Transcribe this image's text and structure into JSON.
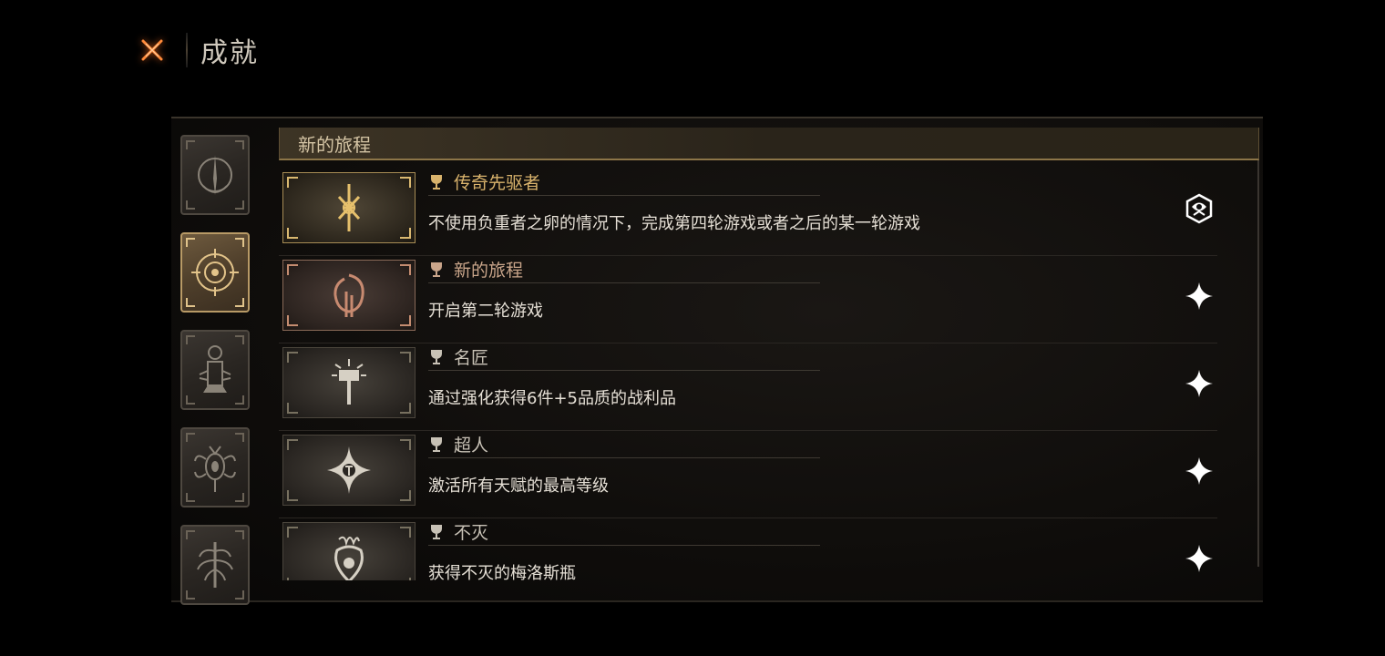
{
  "header": {
    "title": "成就"
  },
  "section": {
    "title": "新的旅程"
  },
  "side_tabs": [
    {
      "icon": "spire-emblem-icon",
      "active": false
    },
    {
      "icon": "compass-emblem-icon",
      "active": true
    },
    {
      "icon": "lantern-emblem-icon",
      "active": false
    },
    {
      "icon": "beast-emblem-icon",
      "active": false
    },
    {
      "icon": "tree-emblem-icon",
      "active": false
    }
  ],
  "achievements": [
    {
      "title": "传奇先驱者",
      "description": "不使用负重者之卵的情况下，完成第四轮游戏或者之后的某一轮游戏",
      "tier": "gold",
      "status_icon": "emblem-complete-icon"
    },
    {
      "title": "新的旅程",
      "description": "开启第二轮游戏",
      "tier": "copper",
      "status_icon": "sparkle-icon"
    },
    {
      "title": "名匠",
      "description": "通过强化获得6件+5品质的战利品",
      "tier": "silver",
      "status_icon": "sparkle-icon"
    },
    {
      "title": "超人",
      "description": "激活所有天赋的最高等级",
      "tier": "silver",
      "status_icon": "sparkle-icon"
    },
    {
      "title": "不灭",
      "description": "获得不灭的梅洛斯瓶",
      "tier": "silver",
      "status_icon": "sparkle-icon"
    }
  ],
  "colors": {
    "gold": "#d9b36c",
    "copper": "#c9a58a",
    "silver": "#c8c2b6",
    "close_accent": "#ff7a2a"
  }
}
